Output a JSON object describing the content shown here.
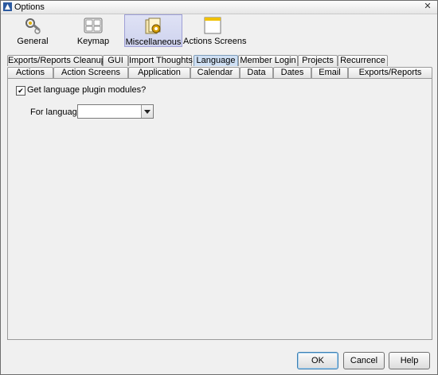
{
  "window": {
    "title": "Options",
    "close_label": "✕"
  },
  "categories": [
    {
      "label": "General",
      "icon": "wrench-gear-icon"
    },
    {
      "label": "Keymap",
      "icon": "keyboard-icon"
    },
    {
      "label": "Miscellaneous",
      "icon": "misc-settings-icon",
      "selected": true
    },
    {
      "label": "Actions Screens",
      "icon": "window-icon"
    }
  ],
  "tabs_row1": [
    "Exports/Reports Cleanup",
    "GUI",
    "Import Thoughts",
    "Language",
    "Member Login",
    "Projects",
    "Recurrence"
  ],
  "tabs_row2": [
    "Actions",
    "Action Screens",
    "Application",
    "Calendar",
    "Data",
    "Dates",
    "Email",
    "Exports/Reports"
  ],
  "active_tab": "Language",
  "panel": {
    "plugin_checkbox_label": "Get language plugin modules?",
    "plugin_checkbox_checked": true,
    "check_mark": "✔",
    "language_label": "For language",
    "language_value": ""
  },
  "buttons": {
    "ok": "OK",
    "cancel": "Cancel",
    "help": "Help"
  },
  "colors": {
    "selected_category_bg": "#cfd3ee",
    "active_tab_bg": "#cfe0f4",
    "default_button_border": "#3c7fb1"
  }
}
